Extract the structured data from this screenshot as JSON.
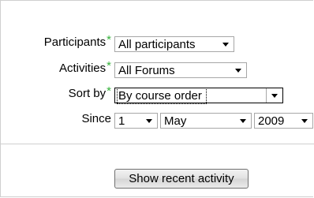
{
  "form": {
    "participants": {
      "label": "Participants",
      "required_mark": "*",
      "value": "All participants"
    },
    "activities": {
      "label": "Activities",
      "required_mark": "*",
      "value": "All Forums"
    },
    "sort_by": {
      "label": "Sort by",
      "required_mark": "*",
      "value": "By course order"
    },
    "since": {
      "label": "Since",
      "day": "1",
      "month": "May",
      "year": "2009"
    }
  },
  "submit": {
    "label": "Show recent activity"
  },
  "colors": {
    "required_mark": "#36b23c",
    "border": "#a7a7a7"
  },
  "icons": {
    "dropdown": "chevron-down-icon"
  }
}
